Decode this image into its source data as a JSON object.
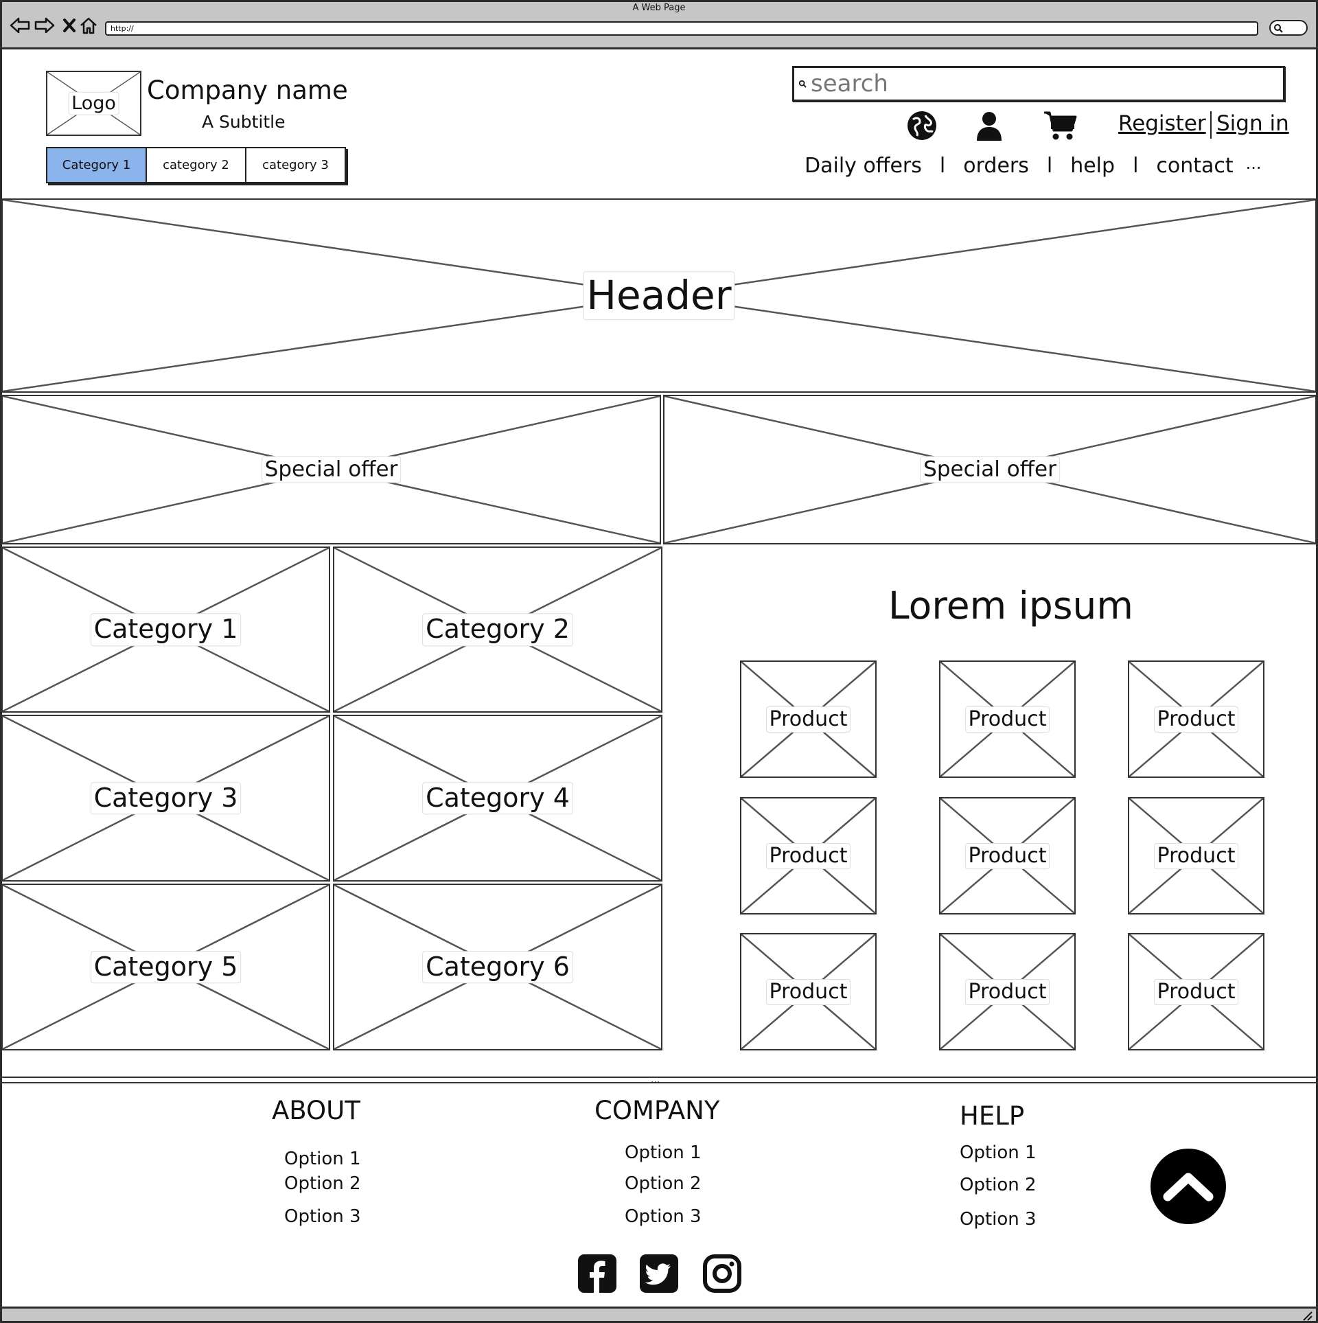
{
  "browser": {
    "window_title": "A Web Page",
    "url": "http://"
  },
  "brand": {
    "logo_label": "Logo",
    "company_name": "Company name",
    "subtitle": "A Subtitle"
  },
  "category_tabs": [
    {
      "label": "Category 1",
      "active": true
    },
    {
      "label": "category 2",
      "active": false
    },
    {
      "label": "category 3",
      "active": false
    }
  ],
  "search": {
    "placeholder": "search"
  },
  "user_links": {
    "register": "Register",
    "sign_in": "Sign in"
  },
  "icons": [
    "globe-icon",
    "user-icon",
    "cart-icon"
  ],
  "top_nav": [
    {
      "label": "Daily offers"
    },
    {
      "label": "orders"
    },
    {
      "label": "help"
    },
    {
      "label": "contact"
    }
  ],
  "top_nav_separator": "l",
  "top_nav_more": "...",
  "hero": {
    "label": "Header"
  },
  "special_offers": [
    {
      "label": "Special offer"
    },
    {
      "label": "Special offer"
    }
  ],
  "categories": [
    {
      "label": "Category 1"
    },
    {
      "label": "Category 2"
    },
    {
      "label": "Category 3"
    },
    {
      "label": "Category 4"
    },
    {
      "label": "Category 5"
    },
    {
      "label": "Category 6"
    }
  ],
  "products_section": {
    "title": "Lorem ipsum",
    "product_label": "Product"
  },
  "footer": {
    "columns": [
      {
        "heading": "ABOUT",
        "options": [
          "Option 1",
          "Option 2",
          "Option 3"
        ]
      },
      {
        "heading": "COMPANY",
        "options": [
          "Option 1",
          "Option 2",
          "Option 3"
        ]
      },
      {
        "heading": "HELP",
        "options": [
          "Option 1",
          "Option 2",
          "Option 3"
        ]
      }
    ],
    "social": [
      "facebook-icon",
      "twitter-icon",
      "instagram-icon"
    ],
    "grip": "..."
  }
}
